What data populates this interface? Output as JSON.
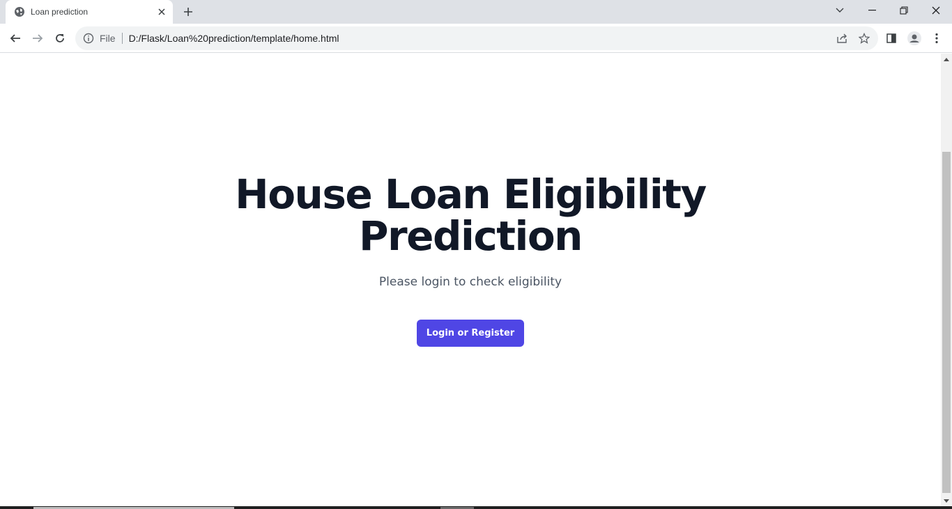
{
  "browser": {
    "tab": {
      "title": "Loan prediction",
      "icon": "globe-icon"
    },
    "address": {
      "scheme_label": "File",
      "url": "D:/Flask/Loan%20prediction/template/home.html"
    }
  },
  "page": {
    "heading_line1": "House Loan Eligibility",
    "heading_line2": "Prediction",
    "subtitle": "Please login to check eligibility",
    "cta_label": "Login or Register"
  },
  "colors": {
    "heading": "#111827",
    "subtitle": "#4b5563",
    "button": "#4f46e5"
  }
}
